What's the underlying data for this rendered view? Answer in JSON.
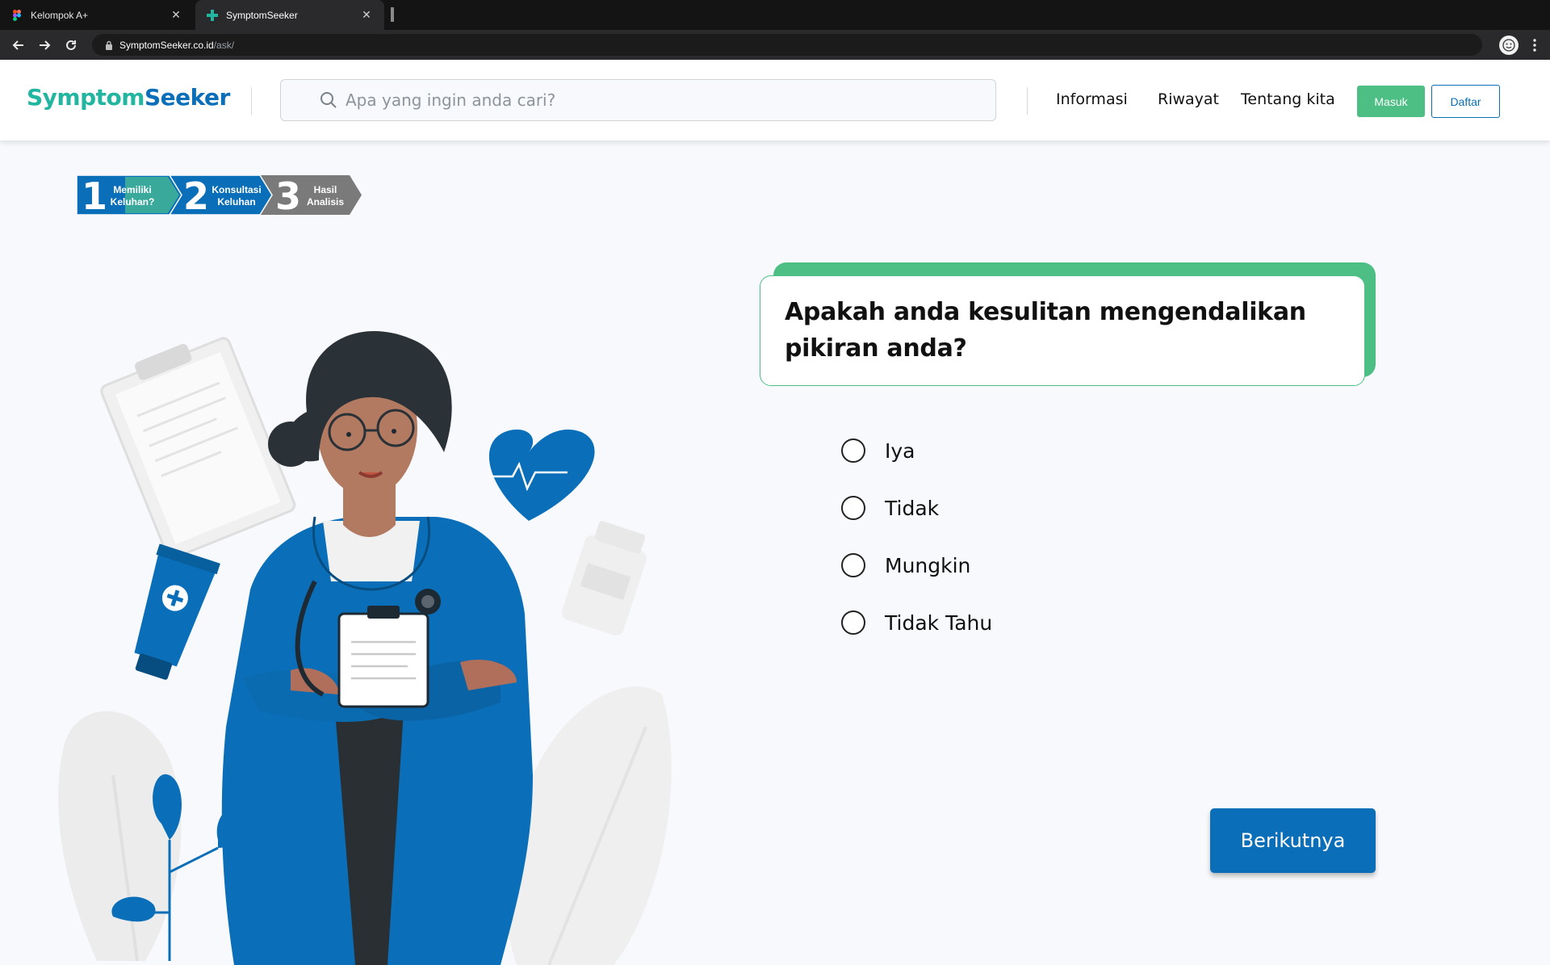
{
  "browser": {
    "tabs": [
      {
        "label": "Kelompok A+",
        "icon": "figma-icon",
        "active": false
      },
      {
        "label": "SymptomSeeker",
        "icon": "plus-icon",
        "active": true
      }
    ],
    "url_host": "SymptomSeeker.co.id",
    "url_path": "/ask/"
  },
  "header": {
    "logo_part1": "Symptom",
    "logo_part2": "Seeker",
    "search_placeholder": "Apa yang ingin anda cari?",
    "nav": [
      "Informasi",
      "Riwayat",
      "Tentang kita"
    ],
    "login_label": "Masuk",
    "register_label": "Daftar"
  },
  "stepper": [
    {
      "number": "1",
      "line1": "Memiliki",
      "line2": "Keluhan?"
    },
    {
      "number": "2",
      "line1": "Konsultasi",
      "line2": "Keluhan"
    },
    {
      "number": "3",
      "line1": "Hasil",
      "line2": "Analisis"
    }
  ],
  "question": {
    "line1": "Apakah anda kesulitan mengendalikan",
    "line2": "pikiran anda?"
  },
  "options": [
    "Iya",
    "Tidak",
    "Mungkin",
    "Tidak Tahu"
  ],
  "next_label": "Berikutnya",
  "colors": {
    "brand_blue": "#0a6fb8",
    "brand_green": "#4dbf85",
    "brand_teal": "#22b5a0",
    "step_inactive": "#7a7a7a"
  }
}
